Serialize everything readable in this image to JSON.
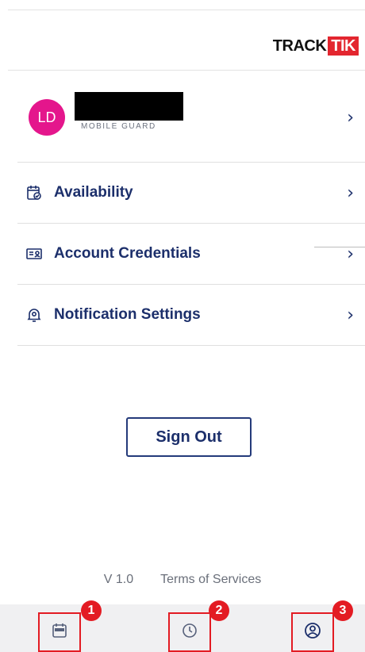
{
  "brand": {
    "logo_track": "TRACK",
    "logo_tik": "TIK",
    "accent": "#e3262f"
  },
  "profile": {
    "initials": "LD",
    "role": "MOBILE GUARD",
    "avatar_color": "#e4168c"
  },
  "menu": {
    "items": [
      {
        "label": "Availability",
        "icon": "calendar-availability-icon"
      },
      {
        "label": "Account Credentials",
        "icon": "id-card-icon"
      },
      {
        "label": "Notification Settings",
        "icon": "bell-settings-icon"
      }
    ],
    "chevron": "›"
  },
  "actions": {
    "sign_out": "Sign Out"
  },
  "footer": {
    "version": "V 1.0",
    "terms": "Terms of Services"
  },
  "tabs": [
    {
      "icon": "calendar-icon",
      "badge": "1"
    },
    {
      "icon": "clock-icon",
      "badge": "2"
    },
    {
      "icon": "profile-icon",
      "badge": "3"
    }
  ],
  "colors": {
    "text_primary": "#1c2f6b",
    "highlight_box": "#e31b23",
    "tabbar_bg": "#f0f0f2"
  }
}
